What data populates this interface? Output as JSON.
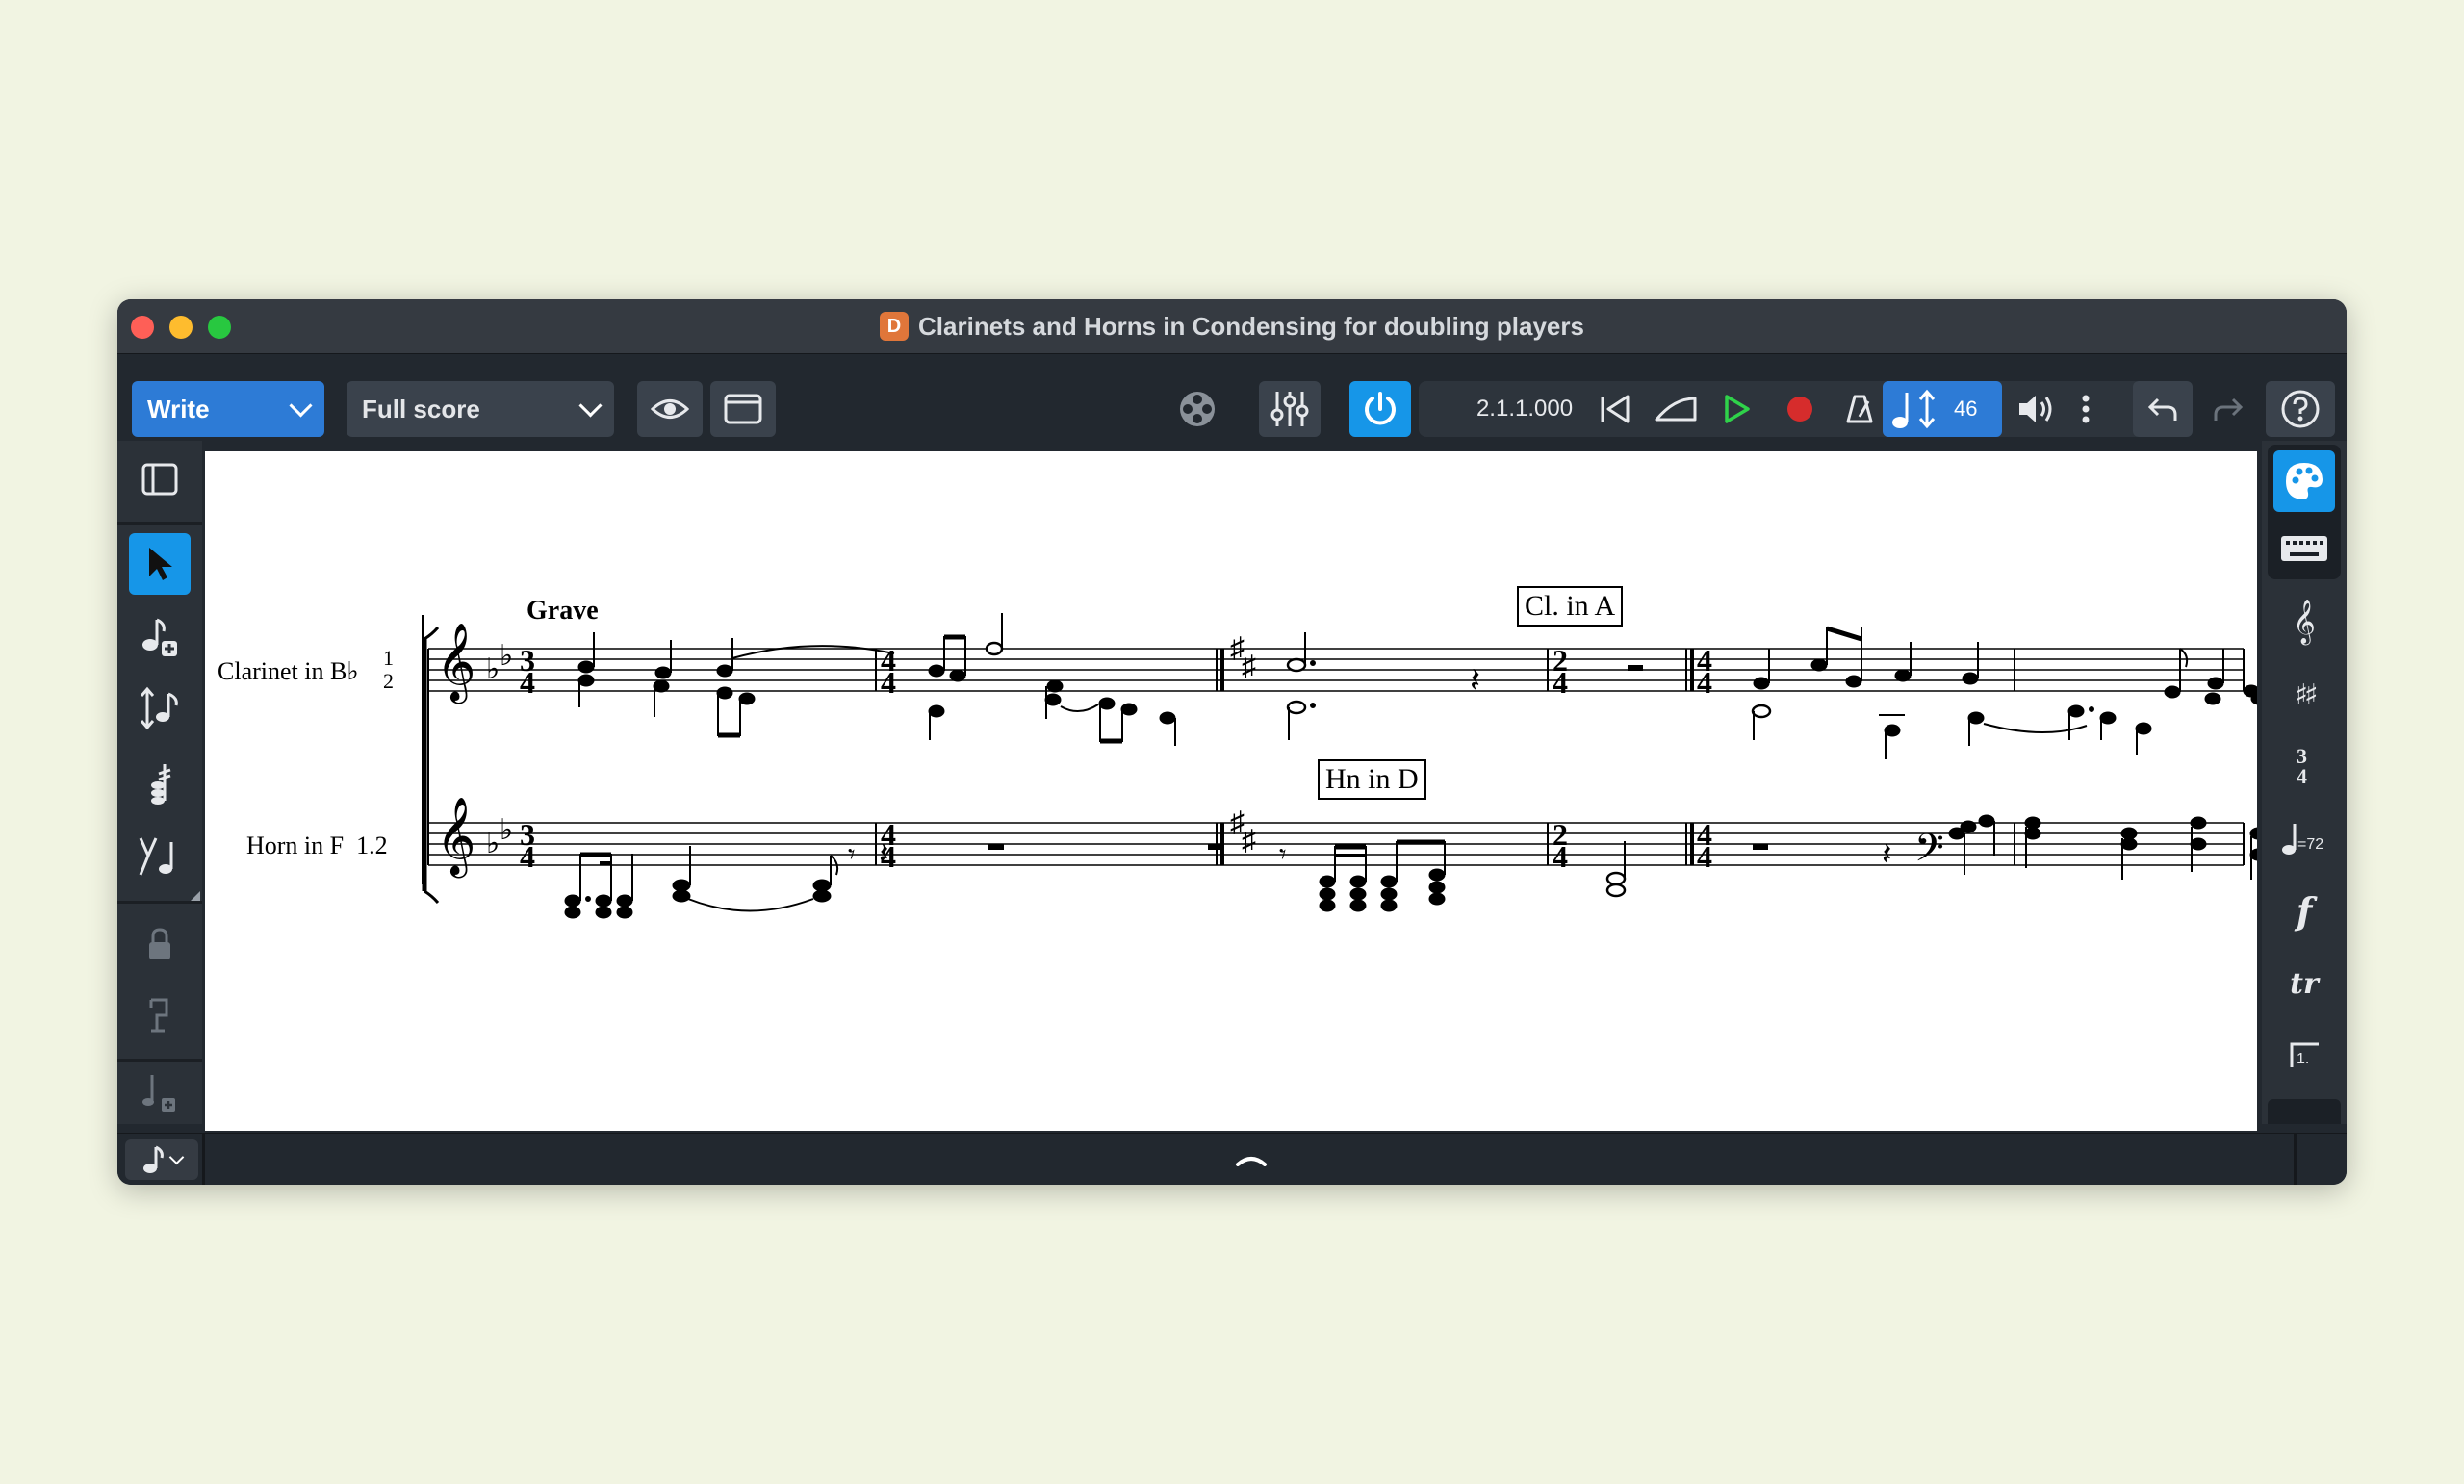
{
  "window": {
    "title": "Clarinets and Horns in Condensing for doubling players"
  },
  "toolbar": {
    "mode": "Write",
    "layout": "Full score",
    "position": "2.1.1.000",
    "tempo": "46"
  },
  "score": {
    "tempo_marking": "Grave",
    "staves": [
      {
        "name": "Clarinet in B♭",
        "players_top": "1",
        "players_bottom": "2"
      },
      {
        "name": "Horn in F  1.2"
      }
    ],
    "boxed_text": [
      "Cl. in A",
      "Hn in D"
    ]
  },
  "colors": {
    "accent": "#1696e8",
    "write": "#2d7bd6",
    "window": "#22282f",
    "page": "#ffffff"
  }
}
